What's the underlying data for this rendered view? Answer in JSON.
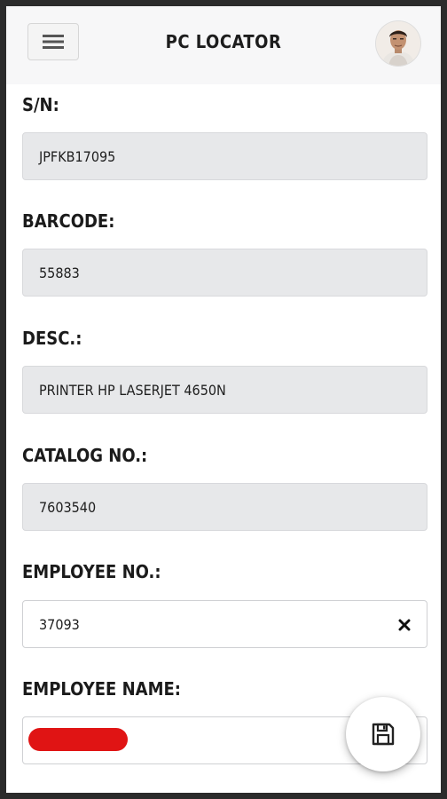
{
  "header": {
    "title": "PC LOCATOR",
    "menu_icon": "hamburger-icon",
    "avatar": "user-avatar"
  },
  "form": {
    "serial": {
      "label": "S/N:",
      "value": "JPFKB17095"
    },
    "barcode": {
      "label": "BARCODE:",
      "value": "55883"
    },
    "desc": {
      "label": "DESC.:",
      "value": "PRINTER HP LASERJET 4650N"
    },
    "catalog": {
      "label": "CATALOG NO.:",
      "value": "7603540"
    },
    "employee_no": {
      "label": "EMPLOYEE NO.:",
      "value": "37093",
      "clear_icon": "close-icon"
    },
    "employee_name": {
      "label": "EMPLOYEE NAME:",
      "value_redacted": true
    }
  },
  "actions": {
    "save_icon": "floppy-disk-icon"
  },
  "colors": {
    "background": "#ffffff",
    "header_bg": "#f7f7f8",
    "readonly_field_bg": "#e7e8ea",
    "redaction": "#e01414",
    "text": "#1b1b1b"
  }
}
